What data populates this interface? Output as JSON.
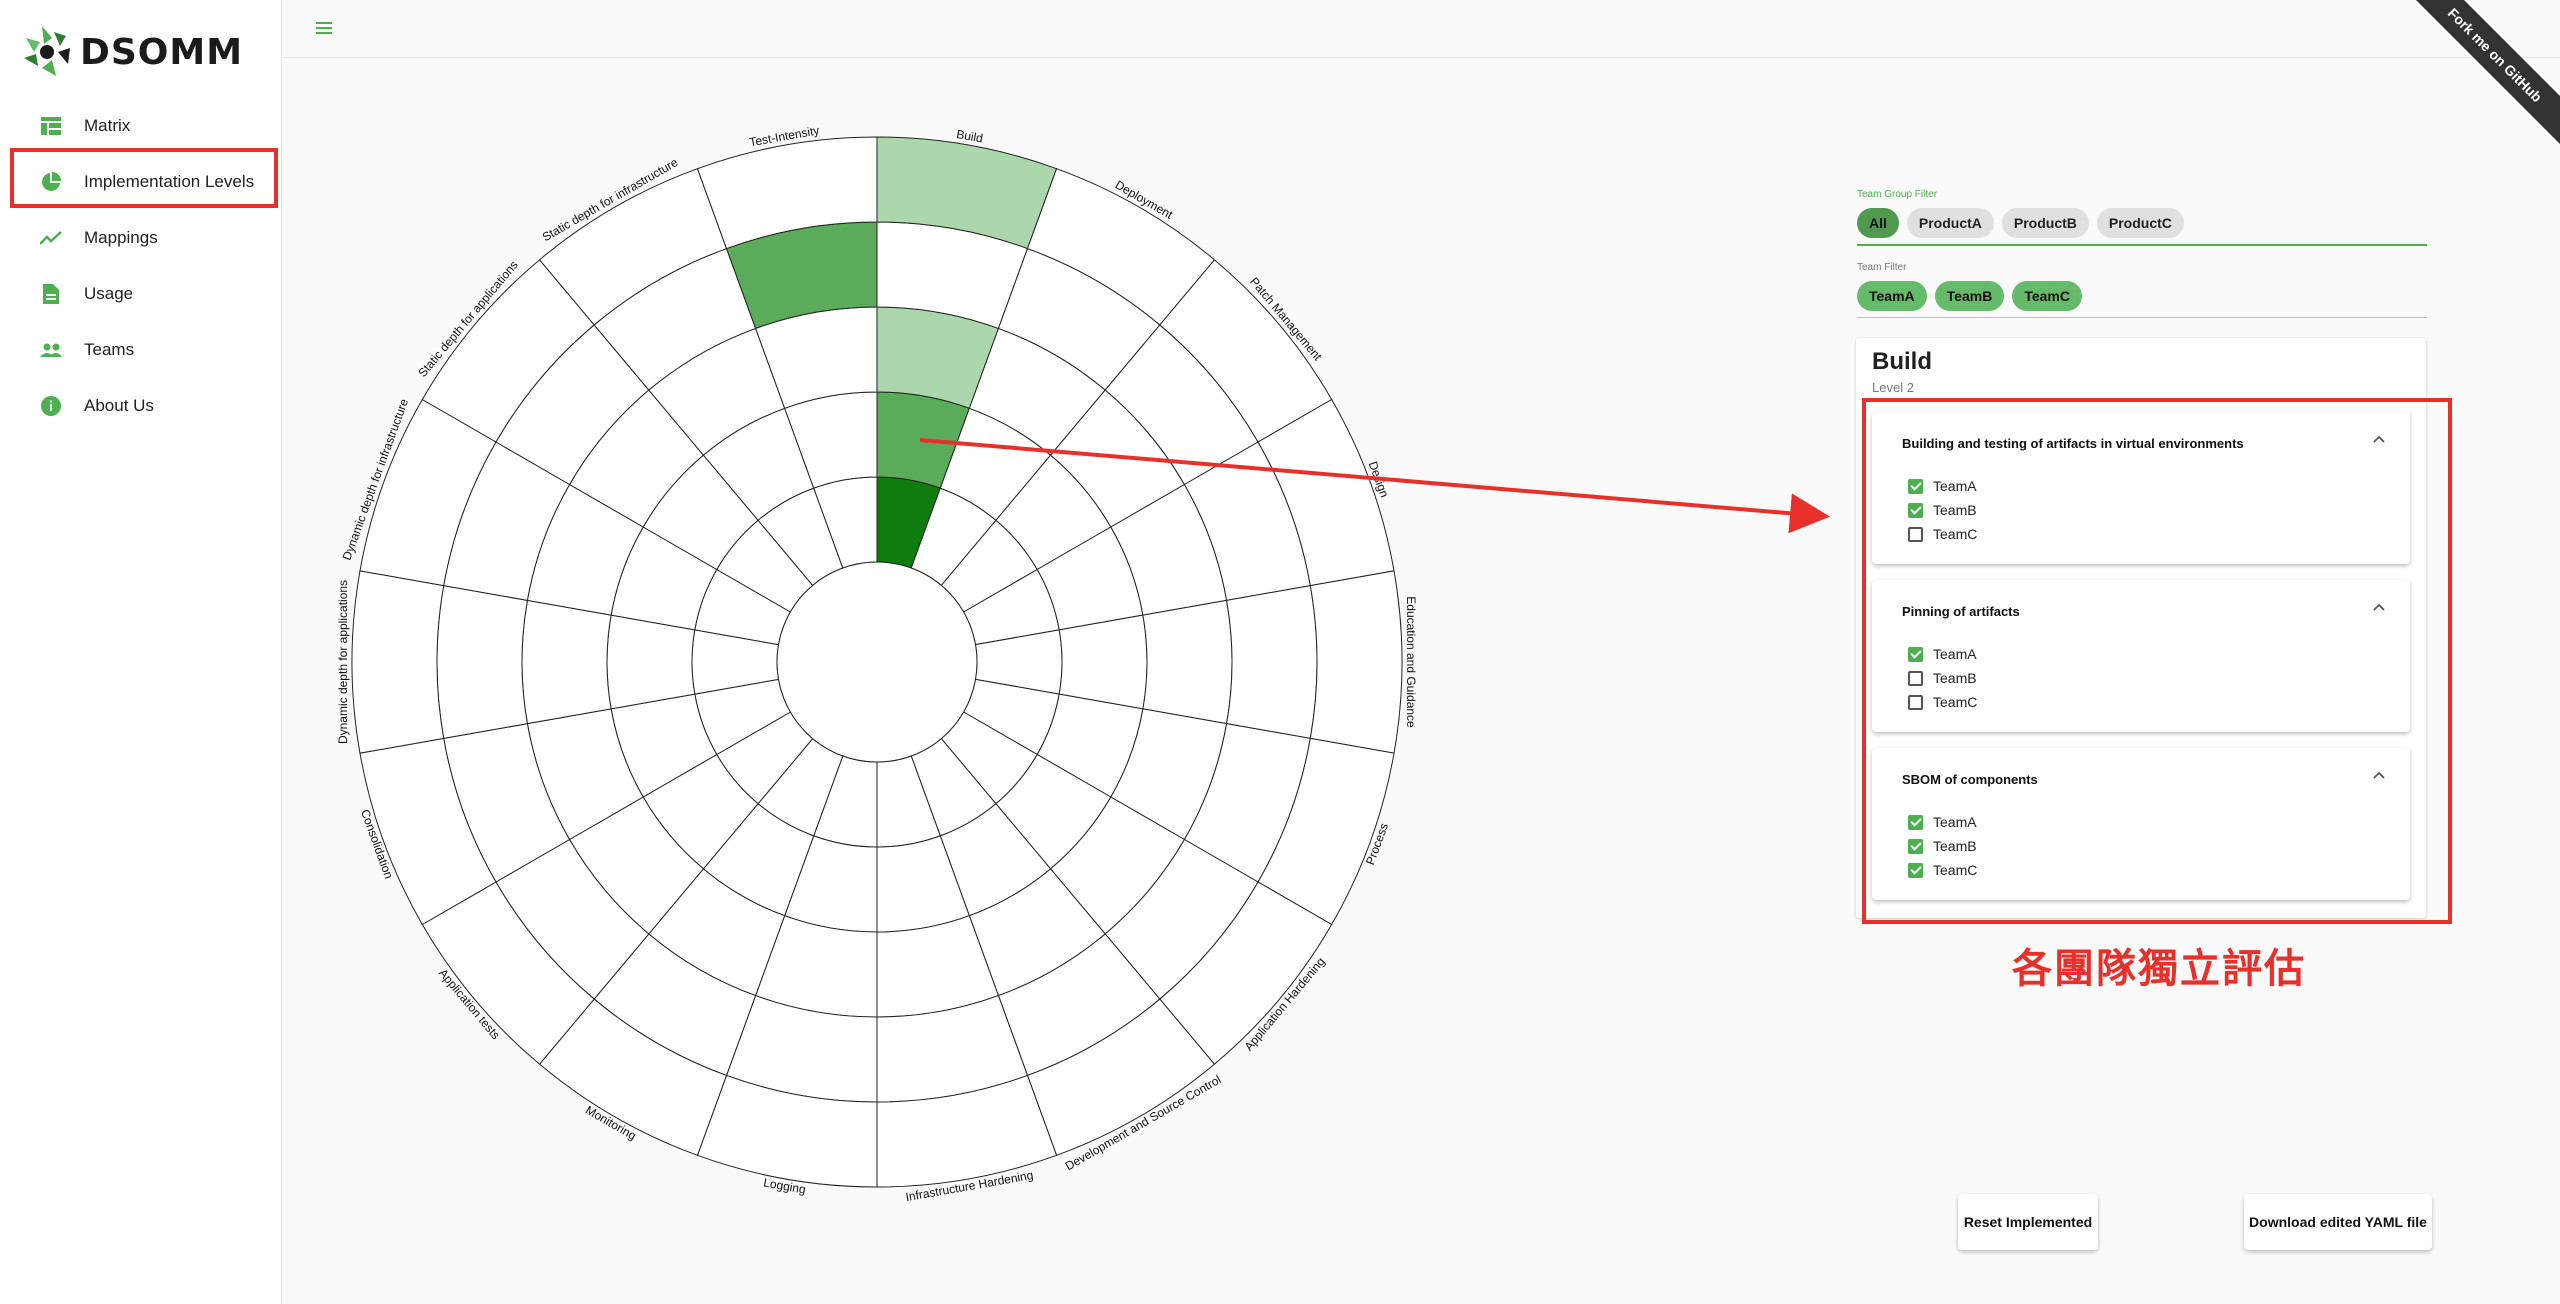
{
  "app": {
    "title": "DSOMM",
    "fork_ribbon": "Fork me on GitHub"
  },
  "sidebar": {
    "items": [
      {
        "label": "Matrix",
        "icon": "table-icon"
      },
      {
        "label": "Implementation Levels",
        "icon": "pie-chart-icon"
      },
      {
        "label": "Mappings",
        "icon": "trending-up-icon"
      },
      {
        "label": "Usage",
        "icon": "document-icon"
      },
      {
        "label": "Teams",
        "icon": "people-icon"
      },
      {
        "label": "About Us",
        "icon": "info-icon"
      }
    ]
  },
  "wheel": {
    "center_label_count": 20,
    "levels": 5,
    "dimensions": [
      "Build",
      "Deployment",
      "Patch Management",
      "Design",
      "Education and Guidance",
      "Process",
      "Application Hardening",
      "Development and Source Control",
      "Infrastructure Hardening",
      "Logging",
      "Monitoring",
      "Application tests",
      "Consolidation",
      "Dynamic depth for applications",
      "Dynamic depth for infrastructure",
      "Static depth for applications",
      "Static depth for infrastructure",
      "Test-Intensity"
    ],
    "filled": [
      {
        "dimension": "Build",
        "level": 1,
        "color": "#0e7c0e"
      },
      {
        "dimension": "Build",
        "level": 2,
        "color": "#5aac5a"
      },
      {
        "dimension": "Build",
        "level": 3,
        "color": "#acd6ac"
      },
      {
        "dimension": "Build",
        "level": 5,
        "color": "#acd6ac"
      },
      {
        "dimension": "Test-Intensity",
        "level": 4,
        "color": "#5aac5a"
      }
    ]
  },
  "filters": {
    "team_group_label": "Team Group Filter",
    "team_groups": [
      "All",
      "ProductA",
      "ProductB",
      "ProductC"
    ],
    "team_group_selected": "All",
    "team_label": "Team Filter",
    "teams": [
      "TeamA",
      "TeamB",
      "TeamC"
    ]
  },
  "detail": {
    "title": "Build",
    "subtitle": "Level 2",
    "activities": [
      {
        "title": "Building and testing of artifacts in virtual environments",
        "teams": [
          {
            "name": "TeamA",
            "checked": true
          },
          {
            "name": "TeamB",
            "checked": true
          },
          {
            "name": "TeamC",
            "checked": false
          }
        ]
      },
      {
        "title": "Pinning of artifacts",
        "teams": [
          {
            "name": "TeamA",
            "checked": true
          },
          {
            "name": "TeamB",
            "checked": false
          },
          {
            "name": "TeamC",
            "checked": false
          }
        ]
      },
      {
        "title": "SBOM of components",
        "teams": [
          {
            "name": "TeamA",
            "checked": true
          },
          {
            "name": "TeamB",
            "checked": true
          },
          {
            "name": "TeamC",
            "checked": true
          }
        ]
      }
    ]
  },
  "annotation": {
    "text": "各團隊獨立評估",
    "color": "#e8302a"
  },
  "buttons": {
    "reset": "Reset Implemented",
    "download": "Download edited YAML file"
  },
  "colors": {
    "accent": "#4caf50",
    "annotation": "#e8302a"
  }
}
